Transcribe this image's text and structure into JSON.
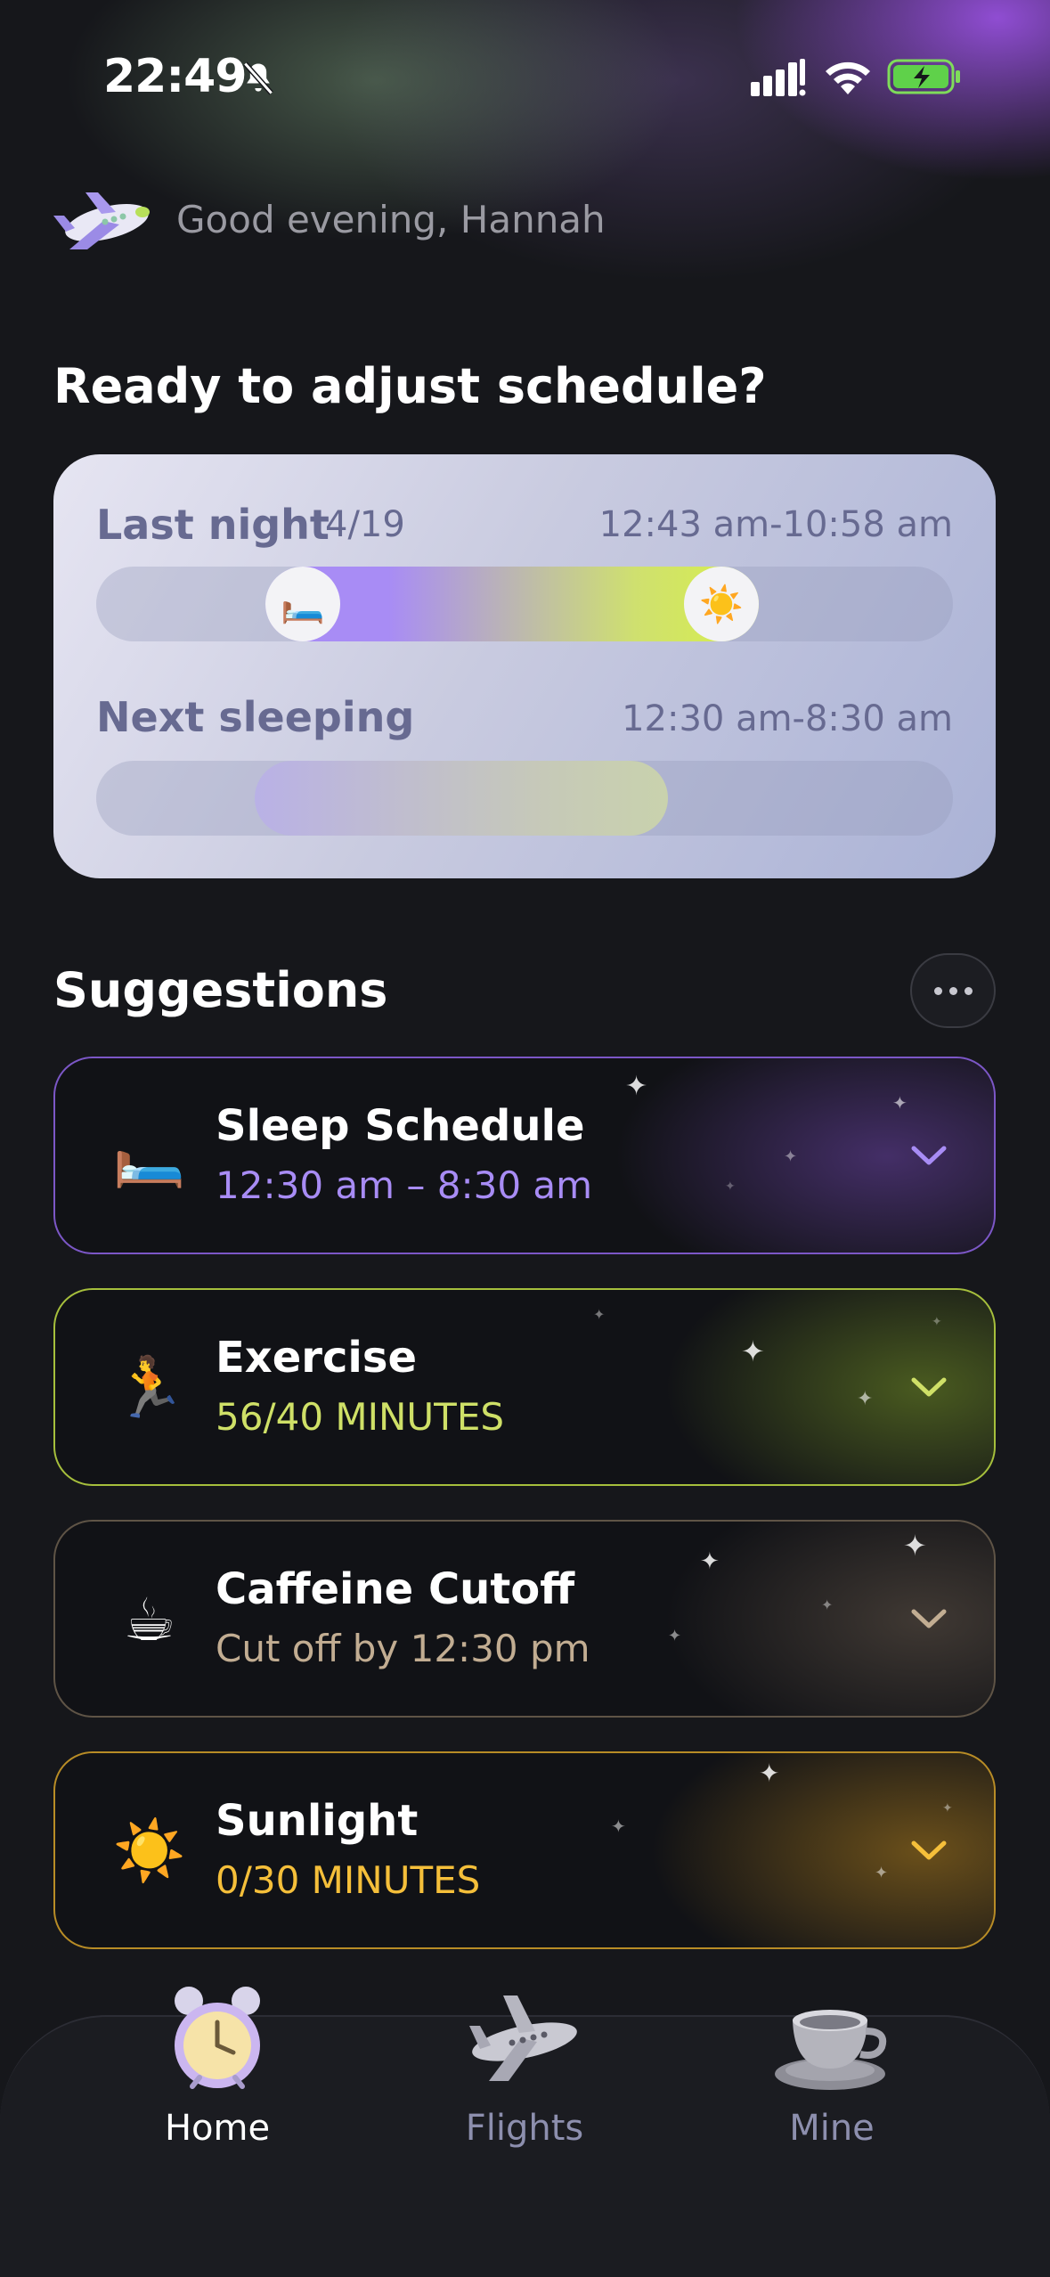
{
  "status_bar": {
    "time": "22:49"
  },
  "greeting": {
    "text": "Good evening, Hannah"
  },
  "ready_title": "Ready to adjust schedule?",
  "schedule": {
    "last_night": {
      "label": "Last night",
      "date": "4/19",
      "time_range": "12:43 am-10:58 am"
    },
    "next_sleeping": {
      "label": "Next sleeping",
      "time_range": "12:30 am-8:30 am"
    }
  },
  "suggestions_title": "Suggestions",
  "suggestions": [
    {
      "title": "Sleep Schedule",
      "subtitle": "12:30 am – 8:30 am",
      "icon": "bed-icon",
      "color": "#a88cf5"
    },
    {
      "title": "Exercise",
      "subtitle": "56/40 MINUTES",
      "icon": "runner-icon",
      "color": "#cfe067"
    },
    {
      "title": "Caffeine Cutoff",
      "subtitle": "Cut off by 12:30 pm",
      "icon": "coffee-icon",
      "color": "#c2ad92"
    },
    {
      "title": "Sunlight",
      "subtitle": "0/30 MINUTES",
      "icon": "sun-icon",
      "color": "#f5bf3a"
    }
  ],
  "tabs": [
    {
      "label": "Home",
      "icon": "alarm-clock-icon",
      "active": true
    },
    {
      "label": "Flights",
      "icon": "airplane-icon",
      "active": false
    },
    {
      "label": "Mine",
      "icon": "teacup-icon",
      "active": false
    }
  ]
}
